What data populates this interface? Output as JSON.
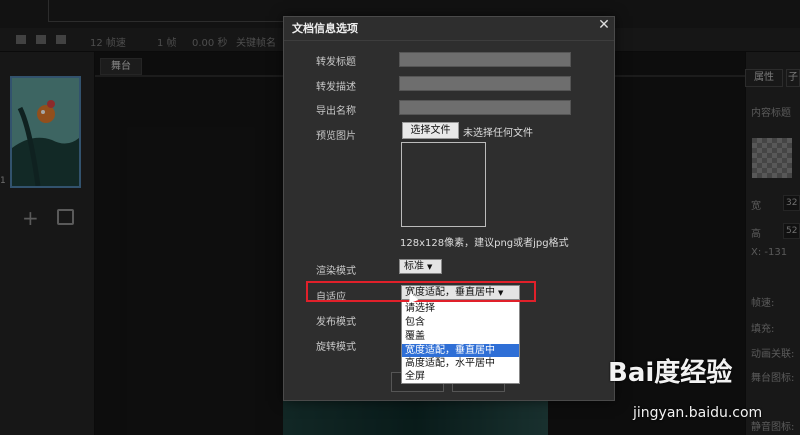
{
  "timeline": {
    "fps": "12 帧速",
    "frames": "1 帧",
    "seconds": "0.00 秒",
    "keyframe": "关键帧名"
  },
  "left_panel": {
    "frame_number": "1",
    "add_icon": "plus-icon",
    "import_icon": "import-icon"
  },
  "stage": {
    "tab_label": "舞台"
  },
  "right_panel": {
    "tab_label": "属性",
    "tab2_label": "子",
    "content_title": "内容标题",
    "width_label": "宽",
    "width_value": "32",
    "height_label": "高",
    "height_value": "52",
    "x_label": "X: -131",
    "frame_rate_label": "帧速:",
    "fill_label": "填充:",
    "animation_label": "动画关联:",
    "ingame_icon_label": "舞台图标:",
    "stage_icon_label": "静音图标:"
  },
  "dialog": {
    "title": "文档信息选项",
    "close_icon": "close-icon",
    "fields": {
      "share_title_label": "转发标题",
      "share_desc_label": "转发描述",
      "export_name_label": "导出名称",
      "preview_label": "预览图片",
      "choose_file_button": "选择文件",
      "no_file_text": "未选择任何文件",
      "hint": "128x128像素，建议png或者jpg格式",
      "render_mode_label": "渲染模式",
      "render_mode_value": "标准",
      "adaptive_label": "自适应",
      "adaptive_value": "宽度适配，垂直居中",
      "publish_mode_label": "发布模式",
      "rotate_mode_label": "旋转模式"
    },
    "adaptive_options": [
      "请选择",
      "包含",
      "覆盖",
      "宽度适配，垂直居中",
      "高度适配，水平居中",
      "全屏"
    ],
    "selected_option_index": 3,
    "highlight_color": "#e0202a",
    "selection_color": "#2f6fd6"
  },
  "watermark": {
    "logo": "Bai度经验",
    "url": "jingyan.baidu.com"
  }
}
